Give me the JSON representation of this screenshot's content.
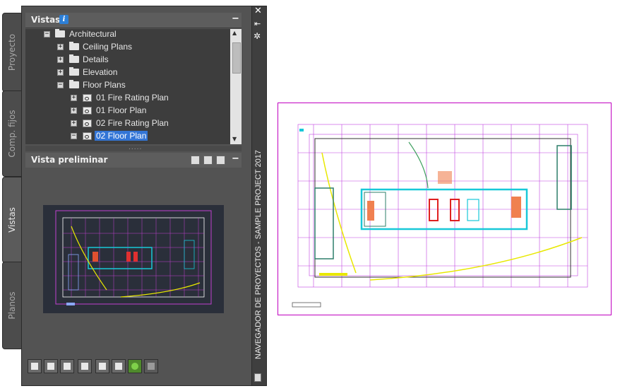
{
  "side_tabs": [
    {
      "label": "Proyecto",
      "active": false
    },
    {
      "label": "Comp. fijos",
      "active": false
    },
    {
      "label": "Vistas",
      "active": true
    },
    {
      "label": "Planos",
      "active": false
    }
  ],
  "views_panel": {
    "title": "Vistas",
    "info_icon": "i",
    "tree": [
      {
        "label": "Architectural",
        "level": 0,
        "expander": "−",
        "icon": "folder-open-icon"
      },
      {
        "label": "Ceiling Plans",
        "level": 1,
        "expander": "+",
        "icon": "folder-icon"
      },
      {
        "label": "Details",
        "level": 1,
        "expander": "+",
        "icon": "folder-icon"
      },
      {
        "label": "Elevation",
        "level": 1,
        "expander": "+",
        "icon": "folder-icon"
      },
      {
        "label": "Floor Plans",
        "level": 1,
        "expander": "−",
        "icon": "folder-open-icon"
      },
      {
        "label": "01 Fire Rating Plan",
        "level": 2,
        "expander": "+",
        "icon": "view-icon"
      },
      {
        "label": "01 Floor Plan",
        "level": 2,
        "expander": "+",
        "icon": "view-icon"
      },
      {
        "label": "02 Fire Rating Plan",
        "level": 2,
        "expander": "+",
        "icon": "view-icon"
      },
      {
        "label": "02 Floor Plan",
        "level": 2,
        "expander": "−",
        "icon": "view-icon",
        "selected": true
      }
    ]
  },
  "preview_panel": {
    "title": "Vista preliminar"
  },
  "palette_title": "NAVEGADOR DE PROYECTOS - SAMPLE PROJECT 2017",
  "bottom_toolbar": [
    "new-view-icon",
    "view-properties-icon",
    "callout-icon",
    "sheet-icon",
    "add-view-icon",
    "table-icon",
    "refresh-icon",
    "repath-icon"
  ],
  "colors": {
    "selection": "#3375d6",
    "sheet_border": "#c000c0",
    "plan_cyan": "#18c8d8",
    "plan_yellow": "#e8e800"
  }
}
